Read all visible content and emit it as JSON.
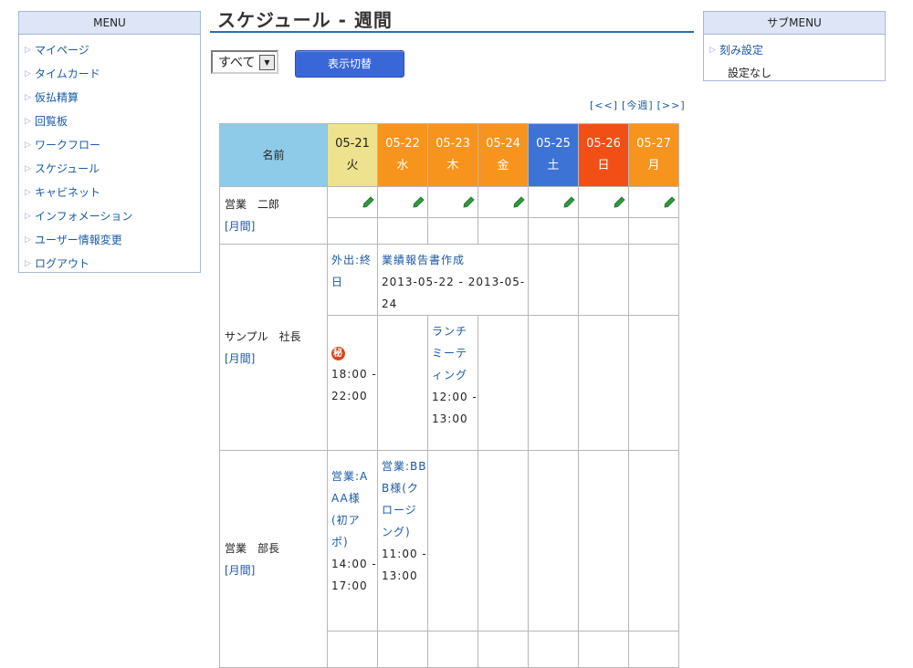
{
  "menu": {
    "title": "MENU",
    "items": [
      "マイページ",
      "タイムカード",
      "仮払精算",
      "回覧板",
      "ワークフロー",
      "スケジュール",
      "キャビネット",
      "インフォメーション",
      "ユーザー情報変更",
      "ログアウト"
    ]
  },
  "submenu": {
    "title": "サブMENU",
    "link": "刻み設定",
    "note": "設定なし"
  },
  "page": {
    "title": "スケジュール - 週間"
  },
  "controls": {
    "group_value": "すべて",
    "switch_label": "表示切替",
    "nav_prev": "[<<]",
    "nav_today": "[今週]",
    "nav_next": "[>>]"
  },
  "table": {
    "name_header": "名前",
    "days": [
      {
        "date": "05-21",
        "weekday": "火",
        "color": "#efe28e"
      },
      {
        "date": "05-22",
        "weekday": "水",
        "color": "#f7941d"
      },
      {
        "date": "05-23",
        "weekday": "木",
        "color": "#f7941d"
      },
      {
        "date": "05-24",
        "weekday": "金",
        "color": "#f7941d"
      },
      {
        "date": "05-25",
        "weekday": "土",
        "color": "#3e73d6"
      },
      {
        "date": "05-26",
        "weekday": "日",
        "color": "#f24f16"
      },
      {
        "date": "05-27",
        "weekday": "月",
        "color": "#f7941d"
      }
    ],
    "month_link": "[月間]",
    "users": [
      {
        "name": "営業　二郎"
      },
      {
        "name": "サンプル　社長",
        "ev1_title": "外出:終日",
        "ev2_title": "業績報告書作成",
        "ev2_time": "2013-05-22 - 2013-05-24",
        "secret_badge": "秘",
        "ev3_time": "18:00 - 22:00",
        "ev4_title": "ランチミーティング",
        "ev4_time": "12:00 - 13:00"
      },
      {
        "name": "営業　部長",
        "ev1_title": "営業:AAA様(初アポ)",
        "ev1_time": "14:00 - 17:00",
        "ev2_title": "営業:BBB様(クロージング)",
        "ev2_time": "11:00 - 13:00"
      }
    ]
  },
  "colors": {
    "accent": "#2a6db0",
    "button": "#3a67d8",
    "menu_head": "#dde5f6"
  },
  "icons": {
    "menu_bullet": "triangle-right-icon",
    "edit": "pencil-icon",
    "dropdown": "chevron-down-icon"
  }
}
